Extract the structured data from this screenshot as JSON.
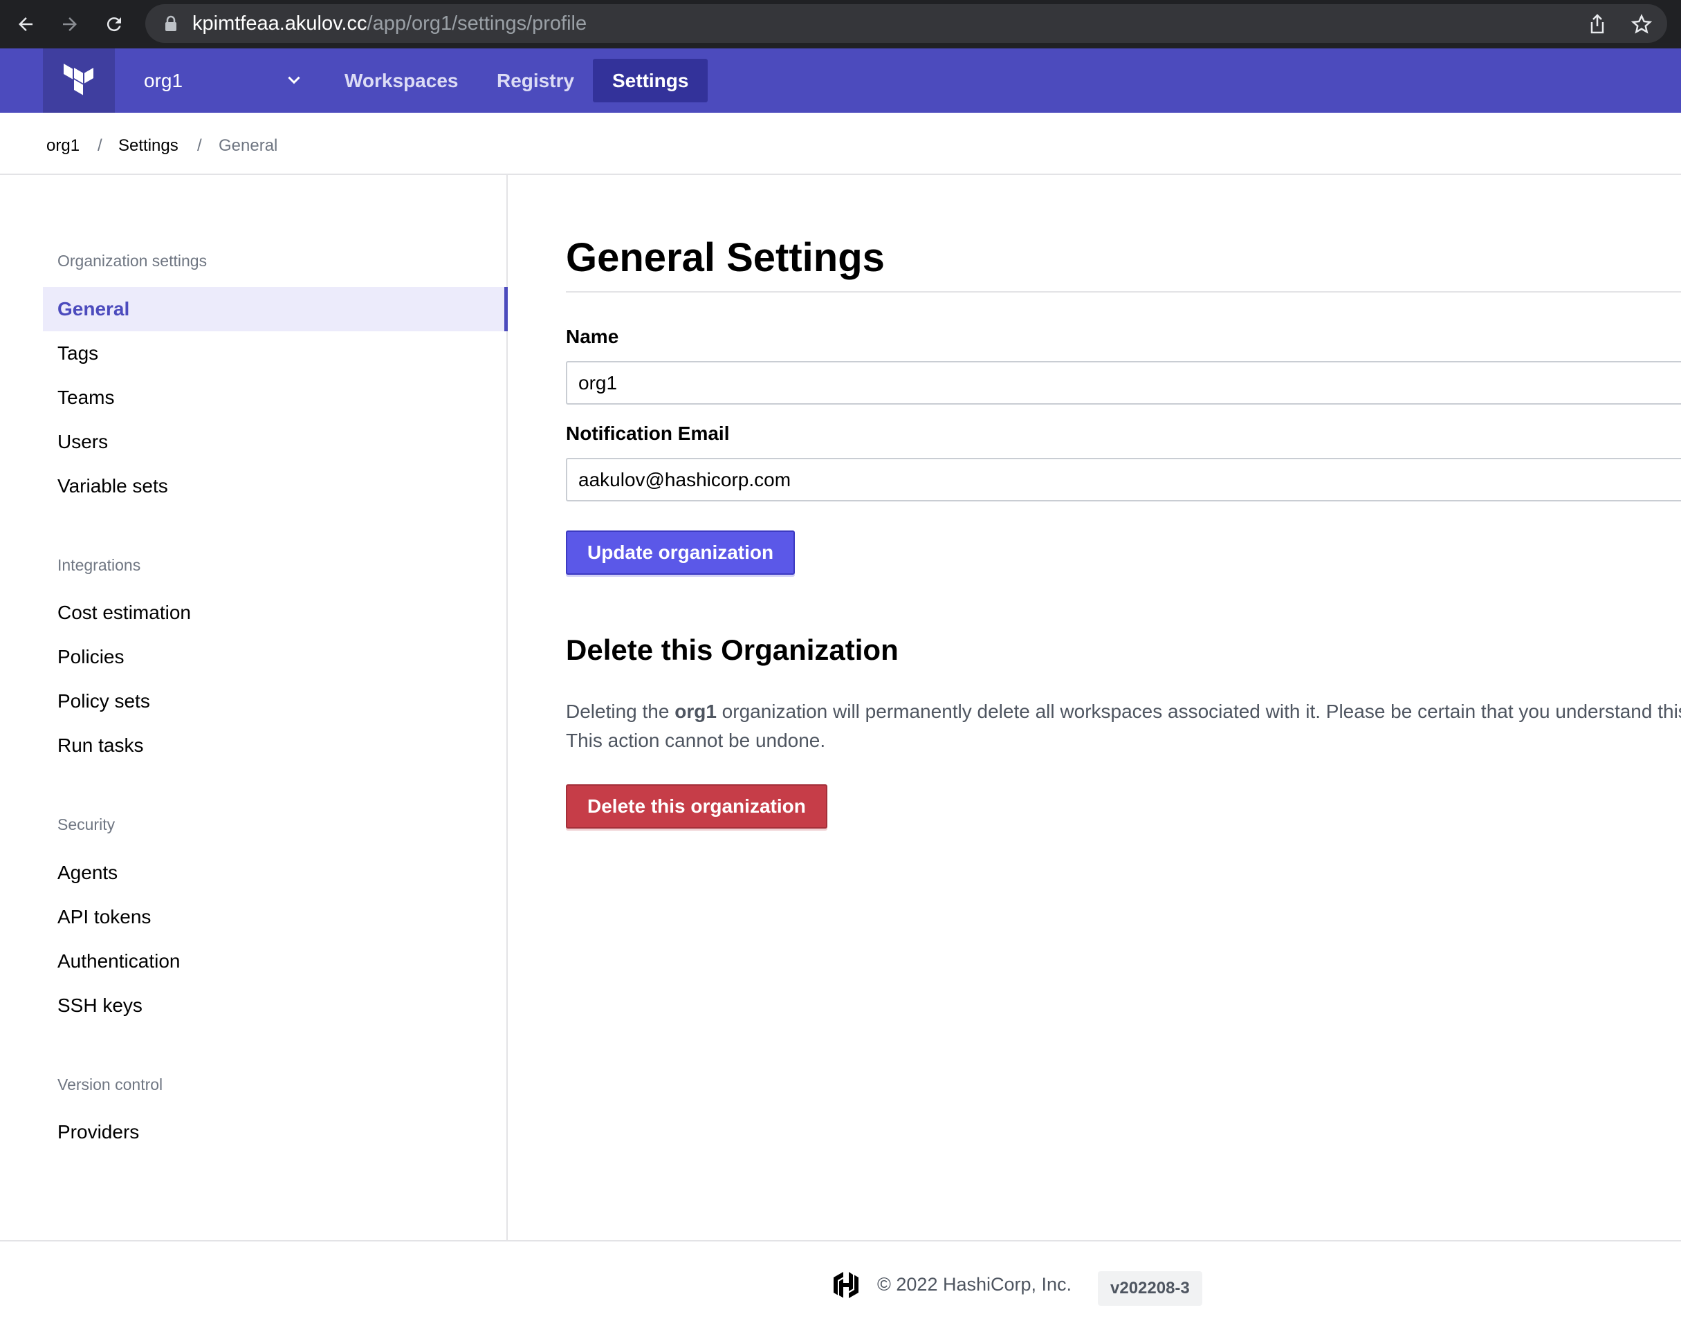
{
  "browser": {
    "url_host": "kpimtfeaa.akulov.cc",
    "url_path": "/app/org1/settings/profile"
  },
  "header": {
    "org_name": "org1",
    "nav": [
      {
        "label": "Workspaces",
        "active": false
      },
      {
        "label": "Registry",
        "active": false
      },
      {
        "label": "Settings",
        "active": true
      }
    ],
    "brand_color": "#4c4bbd"
  },
  "breadcrumb": {
    "items": [
      "org1",
      "Settings",
      "General"
    ],
    "separator": "/"
  },
  "sidebar": {
    "sections": [
      {
        "heading": "Organization settings",
        "items": [
          "General",
          "Tags",
          "Teams",
          "Users",
          "Variable sets"
        ]
      },
      {
        "heading": "Integrations",
        "items": [
          "Cost estimation",
          "Policies",
          "Policy sets",
          "Run tasks"
        ]
      },
      {
        "heading": "Security",
        "items": [
          "Agents",
          "API tokens",
          "Authentication",
          "SSH keys"
        ]
      },
      {
        "heading": "Version control",
        "items": [
          "Providers"
        ]
      }
    ],
    "active_item": "General"
  },
  "main": {
    "title": "General Settings",
    "name_label": "Name",
    "name_value": "org1",
    "email_label": "Notification Email",
    "email_value": "aakulov@hashicorp.com",
    "update_button": "Update organization",
    "delete_section_title": "Delete this Organization",
    "delete_text_before": "Deleting the ",
    "delete_text_org": "org1",
    "delete_text_after": " organization will permanently delete all workspaces associated with it. Please be certain that you understand this. This action cannot be undone.",
    "delete_button": "Delete this organization",
    "primary_color": "#5b58e8",
    "danger_color": "#c63d48"
  },
  "footer": {
    "copyright": "© 2022 HashiCorp, Inc.",
    "version": "v202208-3"
  }
}
